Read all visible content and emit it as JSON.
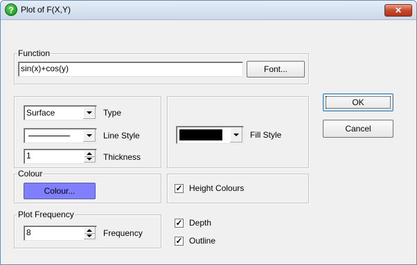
{
  "window": {
    "title": "Plot of F(X,Y)",
    "help_icon_glyph": "?",
    "close_glyph": "✕"
  },
  "function_group": {
    "title": "Function",
    "value": "sin(x)+cos(y)",
    "font_button_label": "Font..."
  },
  "ok_button": {
    "label": "OK"
  },
  "cancel_button": {
    "label": "Cancel"
  },
  "plot_options": {
    "type_value": "Surface",
    "type_label": "Type",
    "line_style_label": "Line Style",
    "thickness_value": "1",
    "thickness_label": "Thickness"
  },
  "fill": {
    "label": "Fill Style",
    "color": "#000000"
  },
  "colour_group": {
    "title": "Colour",
    "button_label": "Colour...",
    "button_color": "#8080ff"
  },
  "height_colours": {
    "label": "Height Colours",
    "checked": true
  },
  "plot_frequency": {
    "title": "Plot Frequency",
    "value": "8",
    "label": "Frequency"
  },
  "depth": {
    "label": "Depth",
    "checked": true
  },
  "outline": {
    "label": "Outline",
    "checked": true
  },
  "check_glyph": "✓",
  "colors": {
    "title_bar_top": "#e4edf7",
    "title_bar_bottom": "#cbd9ea",
    "dialog_bg": "#f0f0f0",
    "close_red": "#c74a2c"
  }
}
